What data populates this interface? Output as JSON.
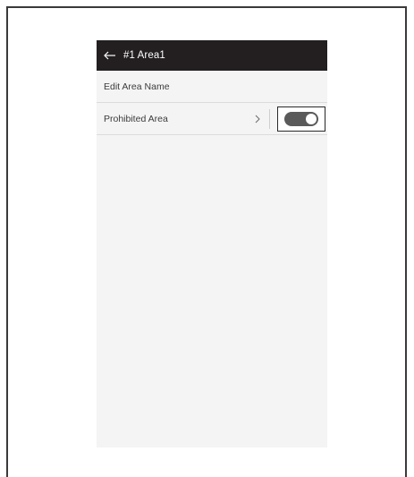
{
  "header": {
    "title": "#1 Area1",
    "back_icon": "arrow-left-icon"
  },
  "rows": [
    {
      "label": "Edit Area Name"
    },
    {
      "label": "Prohibited Area",
      "chevron_icon": "chevron-right-icon",
      "toggle_on": true
    }
  ],
  "colors": {
    "header_bg": "#231f20",
    "screen_bg": "#f4f4f4",
    "toggle_on": "#5a5a5a"
  }
}
